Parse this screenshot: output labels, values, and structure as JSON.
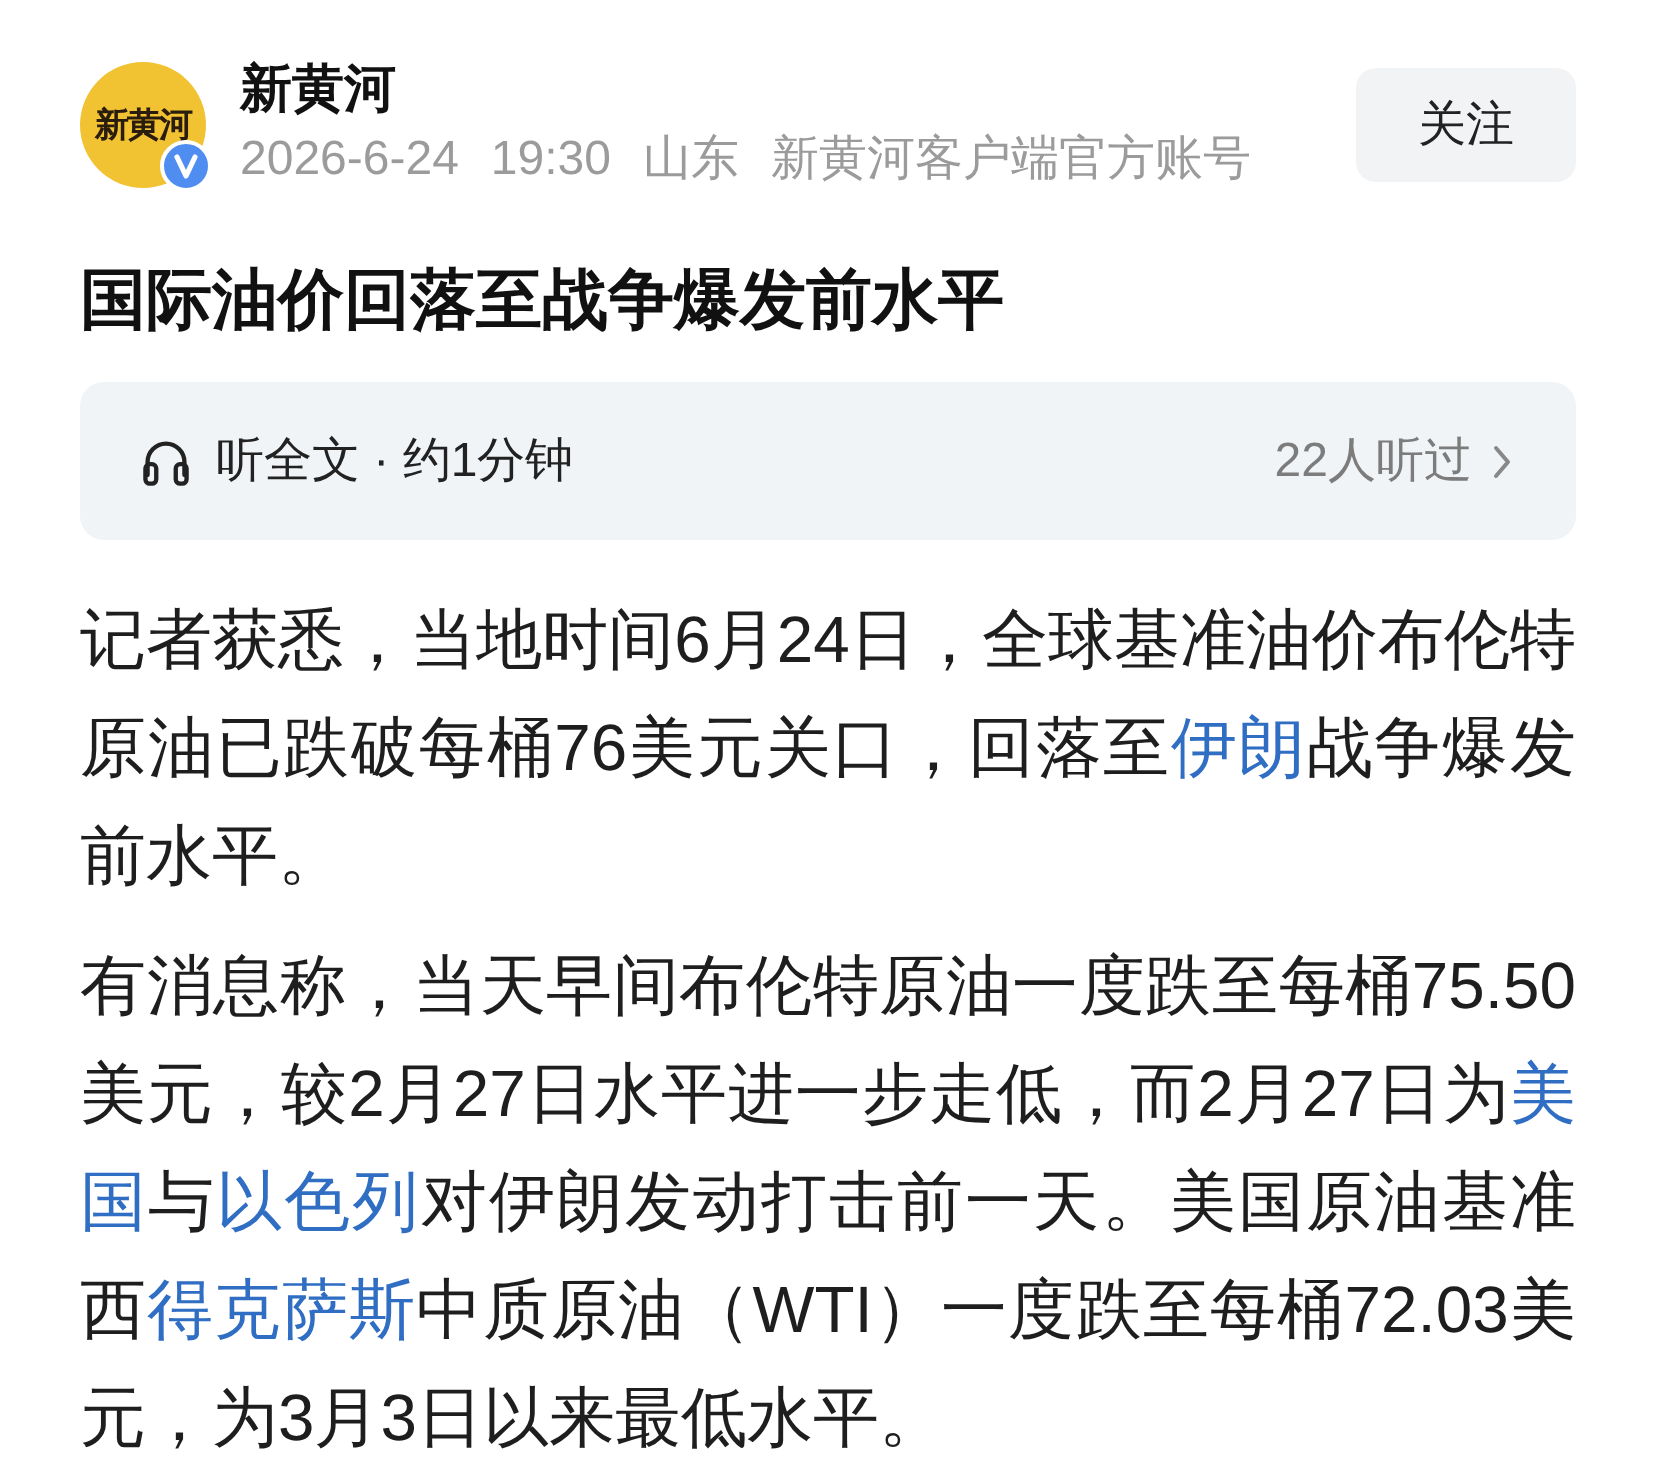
{
  "author": {
    "logo_text": "新黄河",
    "name": "新黄河",
    "verified": true,
    "meta": [
      "2026-6-24",
      "19:30",
      "山东",
      "新黄河客户端官方账号"
    ],
    "follow_button": "关注"
  },
  "title": "国际油价回落至战争爆发前水平",
  "audio_bar": {
    "label": "听全文 · 约1分钟",
    "listeners": "22人听过"
  },
  "paragraphs": [
    {
      "segments": [
        {
          "kind": "text",
          "text": "记者获悉，当地时间6月24日，全球基准油价布伦特原油已跌破每桶76美元关口，回落至"
        },
        {
          "kind": "link",
          "text": "伊朗"
        },
        {
          "kind": "text",
          "text": "战争爆发前水平。"
        }
      ]
    },
    {
      "segments": [
        {
          "kind": "text",
          "text": "有消息称，当天早间布伦特原油一度跌至每桶75.50美元，较2月27日水平进一步走低，而2月27日为"
        },
        {
          "kind": "link",
          "text": "美"
        },
        {
          "kind": "link",
          "text": "国"
        },
        {
          "kind": "text",
          "text": "与"
        },
        {
          "kind": "link",
          "text": "以色列"
        },
        {
          "kind": "text",
          "text": "对伊朗发动打击前一天。美国原油基准西"
        },
        {
          "kind": "link",
          "text": "得克萨斯"
        },
        {
          "kind": "text",
          "text": "中质原油（WTI）一度跌至每桶72.03美元，为3月3日以来最低水平。"
        }
      ]
    }
  ]
}
